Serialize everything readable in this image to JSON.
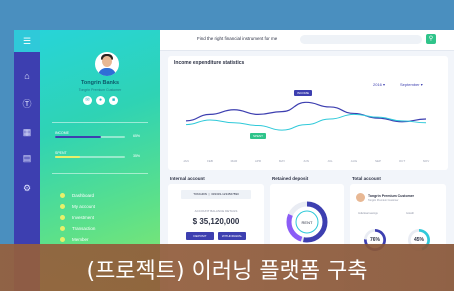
{
  "topbar": {
    "query": "Find the right financial instrument for me",
    "search_placeholder": "",
    "search_icon": "search-icon"
  },
  "iconbar": {
    "icons": [
      "menu-icon",
      "home-icon",
      "dollar-icon",
      "chat-icon",
      "card-icon",
      "settings-icon"
    ]
  },
  "profile": {
    "name": "Tongrin Banks",
    "subtitle": "Tongrin Premium Customer",
    "actions": [
      "message-icon",
      "bell-icon",
      "wallet-icon"
    ]
  },
  "progress": [
    {
      "label": "INCOME",
      "value": "65%",
      "fraction": 0.65,
      "color": "#3d3fb0"
    },
    {
      "label": "SPENT",
      "value": "35%",
      "fraction": 0.35,
      "color": "#e8f06a"
    }
  ],
  "menu": [
    "Dashboard",
    "My account",
    "Investment",
    "Transaction",
    "Member"
  ],
  "chart": {
    "title": "Income expenditure statistics",
    "year": "2016",
    "month": "September",
    "tags": {
      "income": "INCOME",
      "spent": "SPENT"
    }
  },
  "chart_data": {
    "type": "line",
    "x": [
      "JAN",
      "FEB",
      "MAR",
      "APR",
      "MAY",
      "JUN",
      "JUL",
      "AUG",
      "SEP",
      "OCT",
      "NOV"
    ],
    "series": [
      {
        "name": "INCOME",
        "color": "#3d3fb0",
        "values": [
          40,
          47,
          52,
          47,
          50,
          60,
          55,
          48,
          43,
          39,
          42
        ]
      },
      {
        "name": "SPENT",
        "color": "#2fc9d9",
        "values": [
          36,
          41,
          38,
          35,
          30,
          36,
          42,
          47,
          44,
          40,
          38
        ]
      }
    ],
    "ylim": [
      0,
      100
    ],
    "grid": false
  },
  "sections": {
    "internal": "Internal account",
    "retained": "Retained deposit",
    "total": "Total account"
  },
  "internal_account": {
    "bank": "TONGRIN",
    "account_no": "333333-1234567890",
    "balance_label": "ACCOUNT BALANCE DETAILS",
    "balance": "$ 35,120,000",
    "deposit": "DEPOSIT",
    "withdrawal": "WITHDRAWAL"
  },
  "retained": {
    "ring_label": "RENT"
  },
  "total_account": {
    "customer": "Tongrin Premium Customer",
    "customer_sub": "Tongrin Premium Customer",
    "left_label": "Individual savings",
    "right_label": "Growth",
    "left_pct": "76%",
    "right_pct": "45%",
    "left_value": 0.76,
    "right_value": 0.45
  },
  "banner": {
    "text": "(프로젝트) 이러닝 플랫폼 구축"
  }
}
